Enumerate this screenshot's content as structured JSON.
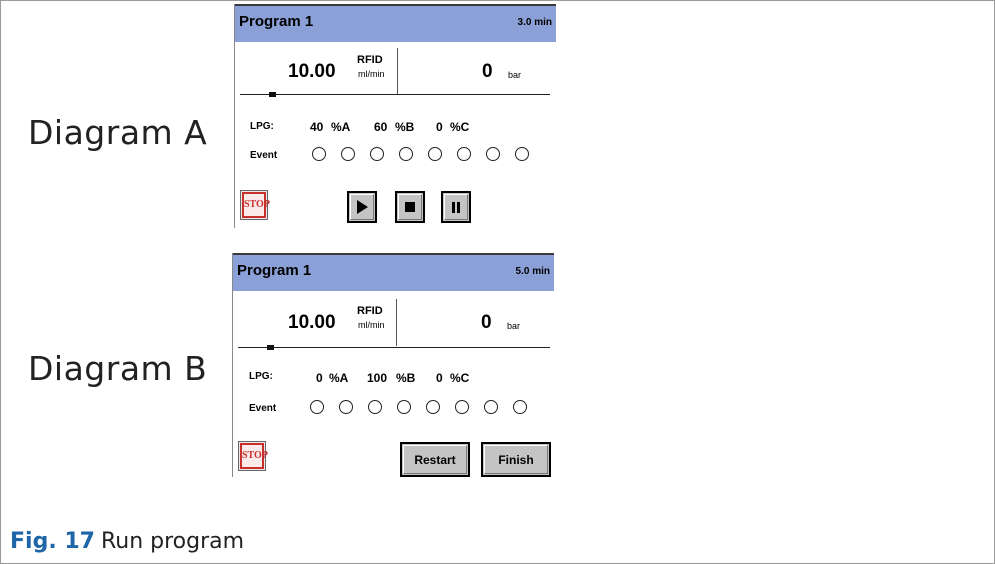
{
  "diagram_a": {
    "label": "Diagram A",
    "program": "Program 1",
    "time": "3.0 min",
    "flow": "10.00",
    "flow_tag": "RFID",
    "flow_unit": "ml/min",
    "pressure": "0",
    "pressure_unit": "bar",
    "lpg_label": "LPG:",
    "lpg_a": "40",
    "lpg_b": "60",
    "lpg_c": "0",
    "unit_a": "%A",
    "unit_b": "%B",
    "unit_c": "%C",
    "event_label": "Event",
    "events": 8,
    "stop": "STOP",
    "buttons": [
      "play-icon",
      "stop-icon",
      "pause-icon"
    ]
  },
  "diagram_b": {
    "label": "Diagram B",
    "program": "Program 1",
    "time": "5.0 min",
    "flow": "10.00",
    "flow_tag": "RFID",
    "flow_unit": "ml/min",
    "pressure": "0",
    "pressure_unit": "bar",
    "lpg_label": "LPG:",
    "lpg_a": "0",
    "lpg_b": "100",
    "lpg_c": "0",
    "unit_a": "%A",
    "unit_b": "%B",
    "unit_c": "%C",
    "event_label": "Event",
    "events": 8,
    "stop": "STOP",
    "restart": "Restart",
    "finish": "Finish"
  },
  "caption": {
    "fig": "Fig. 17",
    "text": "Run program"
  },
  "colors": {
    "title_bar": "#8aa0d6",
    "caption_fig": "#1e66a8",
    "stop_red": "#c8302c"
  }
}
